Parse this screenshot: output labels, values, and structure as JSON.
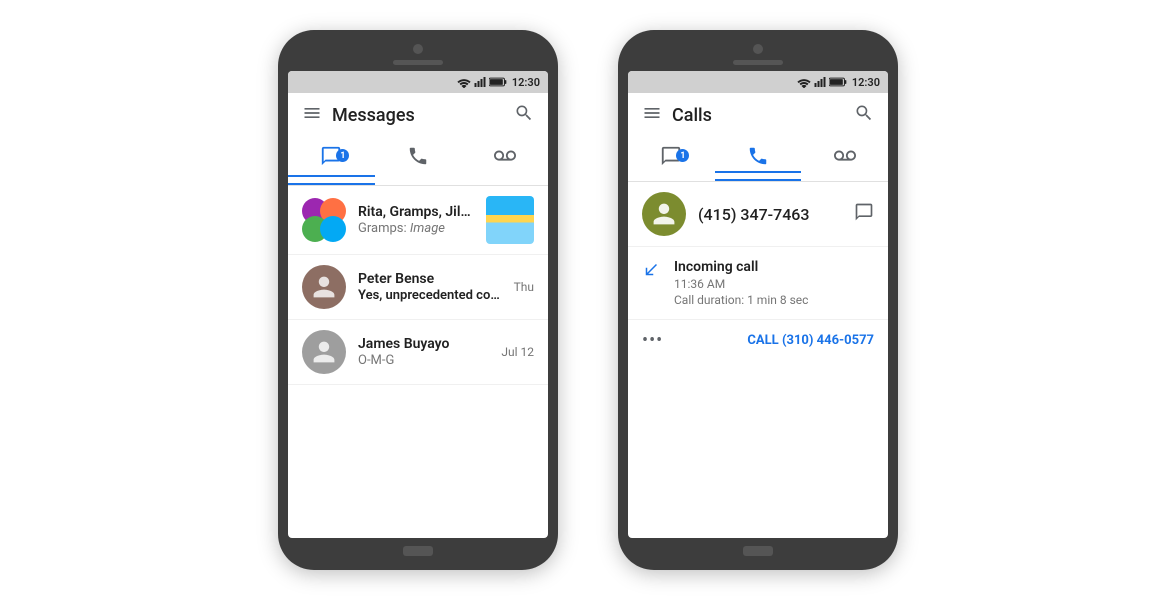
{
  "phones": {
    "left": {
      "statusBar": {
        "time": "12:30"
      },
      "toolbar": {
        "title": "Messages",
        "menuLabel": "menu",
        "searchLabel": "search"
      },
      "tabs": [
        {
          "id": "messages",
          "label": "Messages",
          "active": true,
          "badge": "1"
        },
        {
          "id": "calls",
          "label": "Calls",
          "active": false,
          "badge": ""
        },
        {
          "id": "voicemail",
          "label": "Voicemail",
          "active": false,
          "badge": ""
        }
      ],
      "conversations": [
        {
          "id": 1,
          "title": "Rita, Gramps, Jill, James",
          "subtitle": "Gramps: ",
          "subtitleItalic": "Image",
          "time": "",
          "hasThumb": true,
          "avatarType": "group"
        },
        {
          "id": 2,
          "title": "Peter Bense",
          "subtitle": "Yes, unprecedented consumer value!",
          "time": "Thu",
          "hasThumb": false,
          "avatarType": "person",
          "avatarColor": "#8d6e63"
        },
        {
          "id": 3,
          "title": "James Buyayo",
          "subtitle": "O-M-G",
          "time": "Jul 12",
          "hasThumb": false,
          "avatarType": "person",
          "avatarColor": "#9e9e9e"
        }
      ]
    },
    "right": {
      "statusBar": {
        "time": "12:30"
      },
      "toolbar": {
        "title": "Calls",
        "menuLabel": "menu",
        "searchLabel": "search"
      },
      "tabs": [
        {
          "id": "messages",
          "label": "Messages",
          "active": false,
          "badge": "1"
        },
        {
          "id": "calls",
          "label": "Calls",
          "active": true,
          "badge": ""
        },
        {
          "id": "voicemail",
          "label": "Voicemail",
          "active": false,
          "badge": ""
        }
      ],
      "callContact": {
        "number": "(415) 347-7463",
        "avatarColor": "#7c8c2f"
      },
      "callLog": {
        "type": "Incoming call",
        "time": "11:36 AM",
        "duration": "Call duration: 1 min 8 sec"
      },
      "callActions": {
        "moreLabel": "•••",
        "callLink": "CALL (310) 446-0577"
      }
    }
  }
}
